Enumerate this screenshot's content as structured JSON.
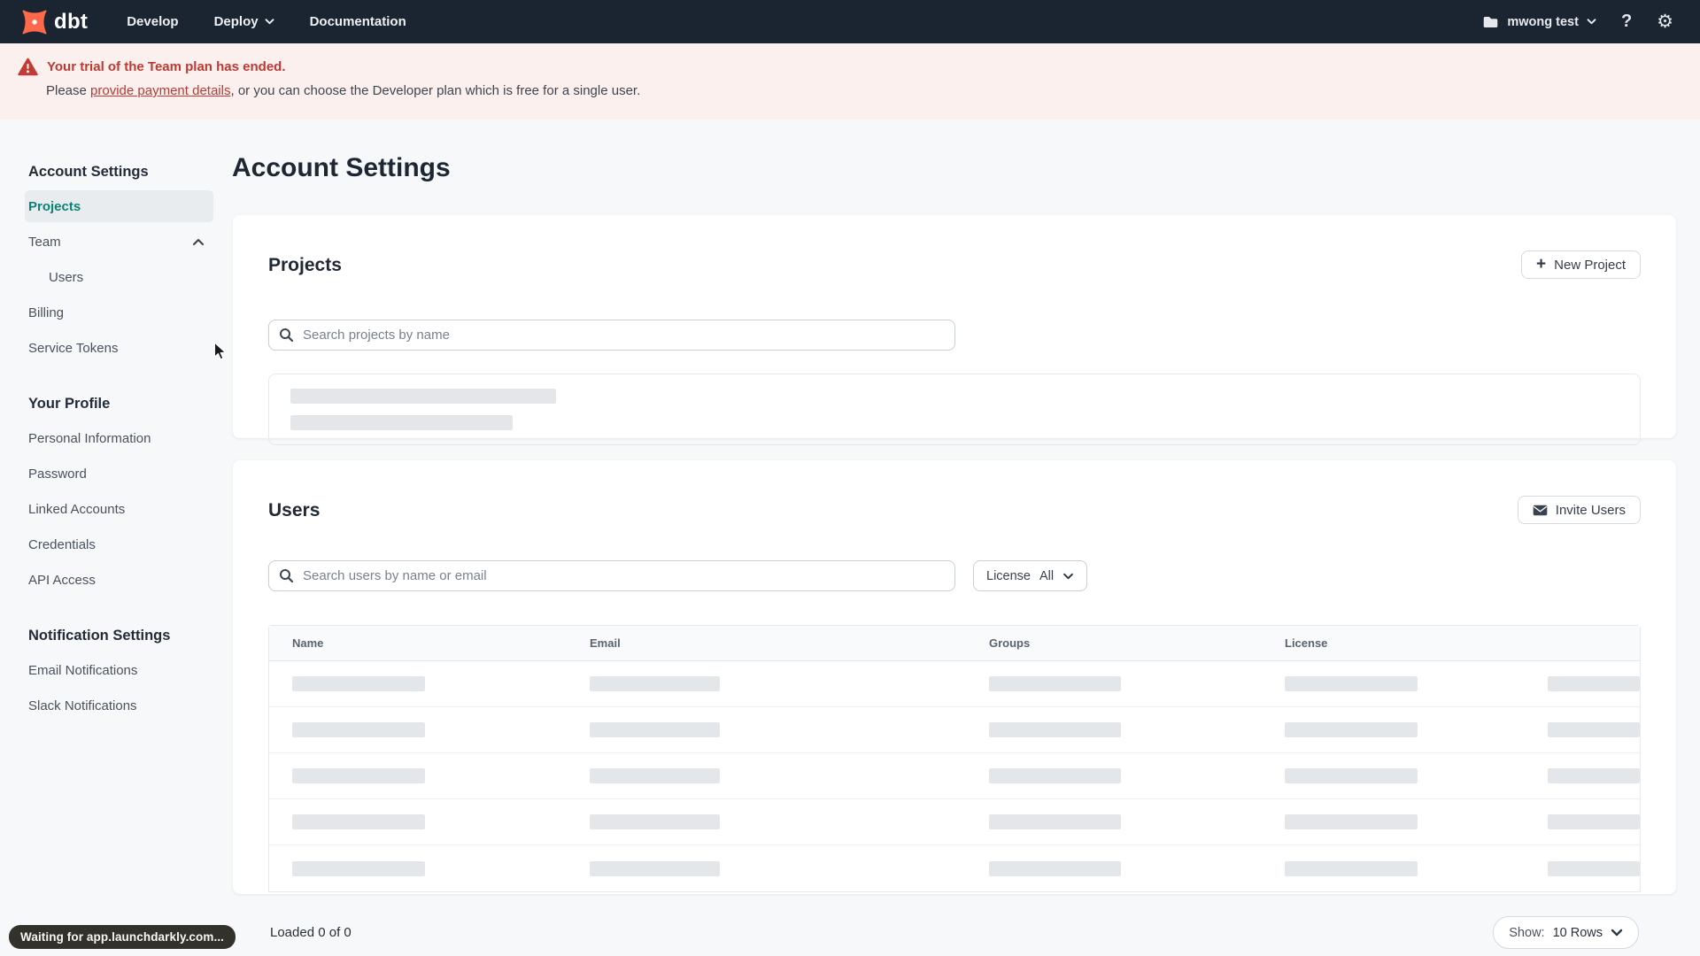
{
  "topnav": {
    "logo_text": "dbt",
    "items": {
      "develop": "Develop",
      "deploy": "Deploy",
      "documentation": "Documentation"
    },
    "account_name": "mwong test"
  },
  "banner": {
    "title": "Your trial of the Team plan has ended.",
    "body_prefix": "Please ",
    "link_text": "provide payment details",
    "body_suffix": ", or you can choose the Developer plan which is free for a single user."
  },
  "sidebar": {
    "sections": [
      {
        "heading": "Account Settings",
        "items": [
          {
            "label": "Projects"
          },
          {
            "label": "Team"
          },
          {
            "label": "Users"
          },
          {
            "label": "Billing"
          },
          {
            "label": "Service Tokens"
          }
        ]
      },
      {
        "heading": "Your Profile",
        "items": [
          {
            "label": "Personal Information"
          },
          {
            "label": "Password"
          },
          {
            "label": "Linked Accounts"
          },
          {
            "label": "Credentials"
          },
          {
            "label": "API Access"
          }
        ]
      },
      {
        "heading": "Notification Settings",
        "items": [
          {
            "label": "Email Notifications"
          },
          {
            "label": "Slack Notifications"
          }
        ]
      }
    ]
  },
  "main": {
    "page_title": "Account Settings",
    "projects_card": {
      "title": "Projects",
      "new_project_button": "New Project",
      "search_placeholder": "Search projects by name"
    },
    "users_card": {
      "title": "Users",
      "invite_button": "Invite Users",
      "search_placeholder": "Search users by name or email",
      "license_filter_label": "License",
      "license_filter_value": "All",
      "table_headers": [
        "Name",
        "Email",
        "Groups",
        "License"
      ],
      "skeleton_row_count": 5
    },
    "footer": {
      "loaded_text": "Loaded 0 of 0",
      "show_label": "Show:",
      "show_value": "10 Rows"
    }
  },
  "status_bar": {
    "text": "Waiting for app.launchdarkly.com..."
  },
  "colors": {
    "topnav_bg": "#1b2531",
    "brand_orange": "#ff694b",
    "accent_teal": "#0c8276",
    "alert_red": "#bb3a33",
    "banner_bg": "#fcf0ee",
    "page_bg": "#f7f8f9"
  }
}
